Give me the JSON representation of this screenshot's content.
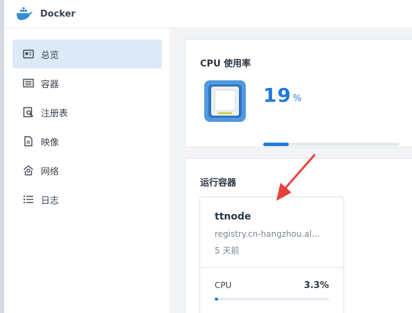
{
  "app": {
    "title": "Docker"
  },
  "sidebar": {
    "items": [
      {
        "label": "总览",
        "icon": "overview-icon",
        "active": true
      },
      {
        "label": "容器",
        "icon": "container-icon",
        "active": false
      },
      {
        "label": "注册表",
        "icon": "registry-icon",
        "active": false
      },
      {
        "label": "映像",
        "icon": "image-icon",
        "active": false
      },
      {
        "label": "网络",
        "icon": "network-icon",
        "active": false
      },
      {
        "label": "日志",
        "icon": "log-icon",
        "active": false
      }
    ]
  },
  "cpu_card": {
    "title": "CPU 使用率",
    "value": "19",
    "unit": "%",
    "usage_fraction": 0.19
  },
  "running_card": {
    "title": "运行容器",
    "containers": [
      {
        "name": "ttnode",
        "image": "registry.cn-hangzhou.al...",
        "time": "5 天前",
        "cpu_label": "CPU",
        "cpu_value": "3.3%",
        "cpu_fraction": 0.033
      }
    ]
  },
  "colors": {
    "accent": "#1f7ad8",
    "active_nav": "#dde9f7",
    "arrow": "#e8413b"
  }
}
